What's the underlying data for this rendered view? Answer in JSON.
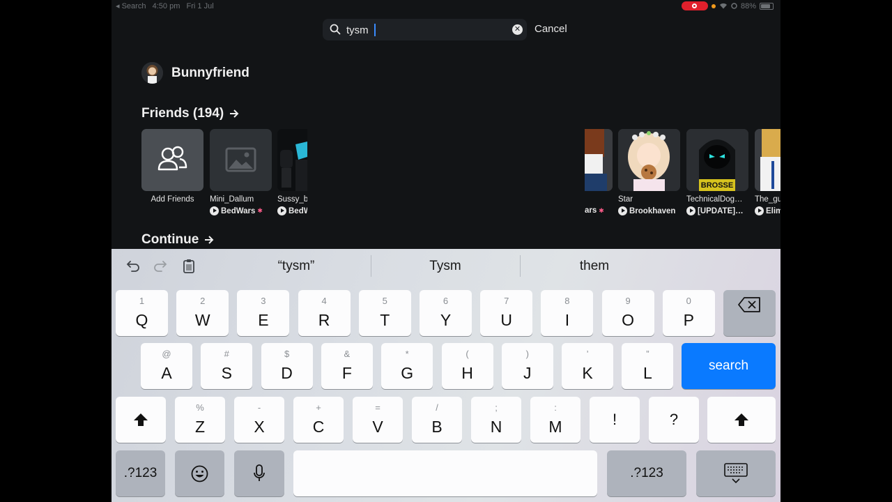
{
  "status_bar": {
    "back_label": "◂ Search",
    "time": "4:50 pm",
    "date": "Fri 1 Jul",
    "battery": "88%"
  },
  "search": {
    "value": "tysm",
    "cancel_label": "Cancel"
  },
  "profile": {
    "username": "Bunnyfriend"
  },
  "friends": {
    "title": "Friends (194)",
    "add_label": "Add Friends",
    "items": [
      {
        "name": "Mini_Dallum",
        "game": "BedWars"
      },
      {
        "name": "Sussy_b",
        "game": "BedW"
      },
      {
        "name": "",
        "game": "ars"
      },
      {
        "name": "Star",
        "game": "Brookhaven"
      },
      {
        "name": "TechnicalDog…",
        "game": "[UPDATE]…"
      },
      {
        "name": "The_gu",
        "game": "Elim"
      }
    ]
  },
  "continue_section": {
    "title": "Continue"
  },
  "keyboard": {
    "suggestions": [
      "“tysm”",
      "Tysm",
      "them"
    ],
    "row1": [
      {
        "sub": "1",
        "main": "Q"
      },
      {
        "sub": "2",
        "main": "W"
      },
      {
        "sub": "3",
        "main": "E"
      },
      {
        "sub": "4",
        "main": "R"
      },
      {
        "sub": "5",
        "main": "T"
      },
      {
        "sub": "6",
        "main": "Y"
      },
      {
        "sub": "7",
        "main": "U"
      },
      {
        "sub": "8",
        "main": "I"
      },
      {
        "sub": "9",
        "main": "O"
      },
      {
        "sub": "0",
        "main": "P"
      }
    ],
    "row2": [
      {
        "sub": "@",
        "main": "A"
      },
      {
        "sub": "#",
        "main": "S"
      },
      {
        "sub": "$",
        "main": "D"
      },
      {
        "sub": "&",
        "main": "F"
      },
      {
        "sub": "*",
        "main": "G"
      },
      {
        "sub": "(",
        "main": "H"
      },
      {
        "sub": ")",
        "main": "J"
      },
      {
        "sub": "’",
        "main": "K"
      },
      {
        "sub": "”",
        "main": "L"
      }
    ],
    "row3": [
      {
        "sub": "%",
        "main": "Z"
      },
      {
        "sub": "-",
        "main": "X"
      },
      {
        "sub": "+",
        "main": "C"
      },
      {
        "sub": "=",
        "main": "V"
      },
      {
        "sub": "/",
        "main": "B"
      },
      {
        "sub": ";",
        "main": "N"
      },
      {
        "sub": ":",
        "main": "M"
      },
      {
        "sub": "",
        "main": "!"
      },
      {
        "sub": "",
        "main": "?"
      }
    ],
    "search_label": "search",
    "numbers_label": ".?123"
  },
  "colors": {
    "accent_blue": "#0a7aff",
    "background": "#121416",
    "record_red": "#e0202c"
  }
}
